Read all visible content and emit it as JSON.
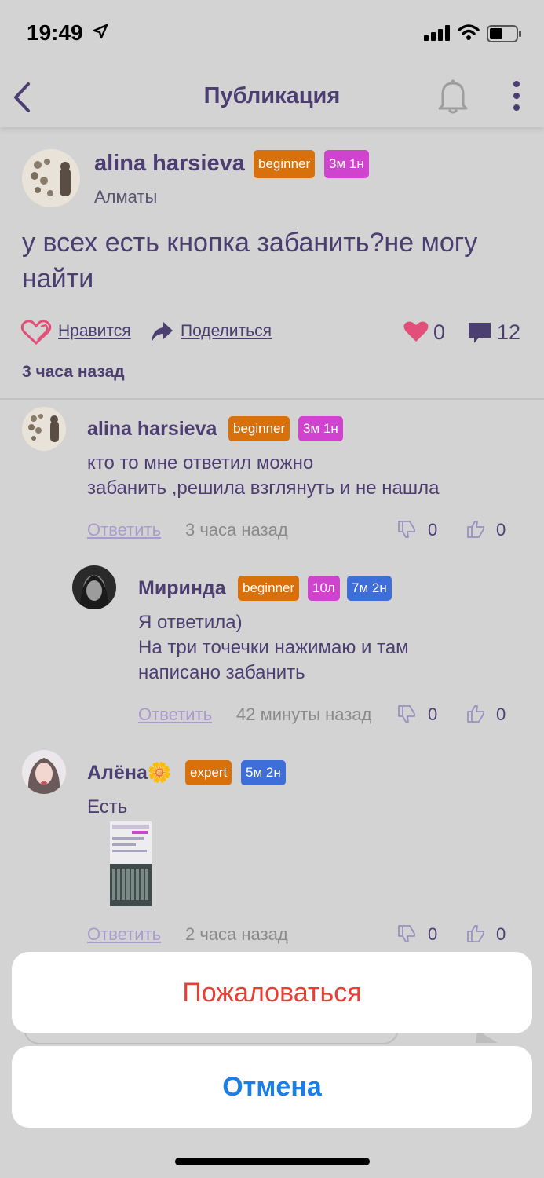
{
  "status": {
    "time": "19:49"
  },
  "nav": {
    "title": "Публикация",
    "back_icon": "chevron-left-icon",
    "bell_icon": "bell-icon",
    "more_icon": "more-vertical-icon"
  },
  "post": {
    "author": "alina harsieva",
    "badges": [
      "beginner",
      "3м 1н"
    ],
    "city": "Алматы",
    "text": "у всех есть кнопка забанить?не могу найти",
    "like_label": "Нравится",
    "share_label": "Поделиться",
    "likes": "0",
    "comments": "12",
    "time": "3 часа назад"
  },
  "comments": [
    {
      "author": "alina harsieva",
      "badges": [
        "beginner",
        "3м 1н"
      ],
      "text": "кто то мне ответил можно\nзабанить ,решила взглянуть и не нашла",
      "reply_label": "Ответить",
      "time": "3 часа назад",
      "dislikes": "0",
      "likes": "0"
    },
    {
      "author": "Миринда",
      "badges": [
        "beginner",
        "10л",
        "7м 2н"
      ],
      "text": "Я ответила)\nНа три точечки нажимаю и там\nнаписано забанить",
      "reply_label": "Ответить",
      "time": "42 минуты назад",
      "dislikes": "0",
      "likes": "0"
    },
    {
      "author": "Алёна🌼",
      "badges": [
        "expert",
        "5м 2н"
      ],
      "text": "Есть",
      "reply_label": "Ответить",
      "time": "2 часа назад",
      "dislikes": "0",
      "likes": "0"
    }
  ],
  "sheet": {
    "report_label": "Пожаловаться",
    "cancel_label": "Отмена"
  },
  "colors": {
    "accent": "#4b3f72",
    "badge_orange": "#d8700b",
    "badge_magenta": "#cf43cf",
    "badge_blue": "#3e6ed8",
    "report_red": "#ea3e32",
    "cancel_blue": "#1a7ee6",
    "like_pink": "#e2507a"
  }
}
